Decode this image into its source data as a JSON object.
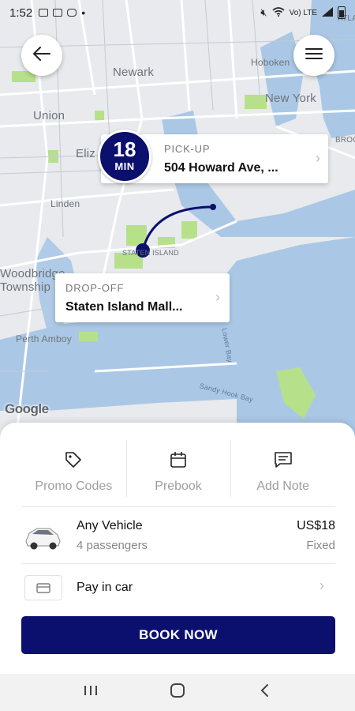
{
  "status_bar": {
    "time": "1:52",
    "right_text": "Vo) LTE",
    "icons_left": [
      "image-icon",
      "mail-icon",
      "instagram-icon",
      "dot-icon"
    ],
    "icons_right": [
      "mute-icon",
      "wifi-icon",
      "signal-icon",
      "battery-icon"
    ]
  },
  "map": {
    "labels": {
      "newark": "Newark",
      "hoboken": "Hoboken",
      "new_york": "New York",
      "union": "Union",
      "elizabeth": "Eliz",
      "linden": "Linden",
      "woodbridge": "Woodbridge",
      "township": "Township",
      "staten_island": "STATEN ISLAND",
      "perth_amboy": "Perth Amboy",
      "brooklyn": "BROO",
      "atla": "ATLA",
      "lower_bay": "Lower Bay",
      "sandy_hook_bay": "Sandy Hook Bay"
    },
    "route_color": "#0b0f6e",
    "attribution": "Google"
  },
  "pickup": {
    "eta_number": "18",
    "eta_unit": "MIN",
    "label": "PICK-UP",
    "address": "504 Howard Ave, ..."
  },
  "dropoff": {
    "label": "DROP-OFF",
    "address": "Staten Island Mall..."
  },
  "options": [
    {
      "label": "Promo Codes",
      "icon": "tag-icon"
    },
    {
      "label": "Prebook",
      "icon": "calendar-icon"
    },
    {
      "label": "Add Note",
      "icon": "message-icon"
    }
  ],
  "vehicle": {
    "name": "Any Vehicle",
    "passengers": "4 passengers",
    "price": "US$18",
    "price_type": "Fixed"
  },
  "payment": {
    "label": "Pay in car",
    "icon": "credit-card-icon"
  },
  "book_button": "BOOK NOW",
  "colors": {
    "brand": "#0b0f6e",
    "water": "#aac8e6",
    "park": "#b7e08a",
    "map_bg": "#e8eaed"
  }
}
